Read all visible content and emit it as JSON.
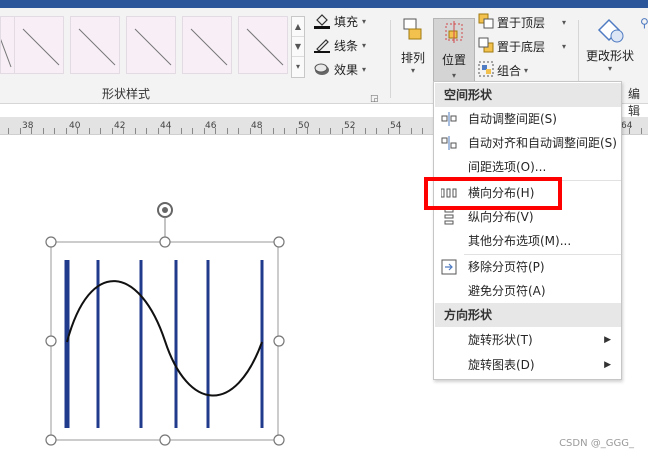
{
  "ribbon": {
    "shape_styles_label": "形状样式",
    "fill_label": "填充",
    "line_label": "线条",
    "effect_label": "效果",
    "arrange_label": "排列",
    "position_label": "位置",
    "bring_to_front_label": "置于顶层",
    "send_to_back_label": "置于底层",
    "group_label": "组合",
    "change_shape_label": "更改形状",
    "edit_label": "编辑"
  },
  "ruler": {
    "ticks": [
      "38",
      "40",
      "42",
      "44",
      "46",
      "48",
      "50",
      "52",
      "54",
      "64"
    ]
  },
  "menu": {
    "section1_title": "空间形状",
    "items1": [
      "自动调整间距(S)",
      "自动对齐和自动调整间距(S)",
      "间距选项(O)...",
      "横向分布(H)",
      "纵向分布(V)",
      "其他分布选项(M)...",
      "移除分页符(P)",
      "避免分页符(A)"
    ],
    "section2_title": "方向形状",
    "items2": [
      "旋转形状(T)",
      "旋转图表(D)"
    ]
  },
  "colors": {
    "ribbon_top": "#2b579a",
    "bar_blue": "#203a8c",
    "highlight": "#ff0000"
  },
  "watermark": "CSDN @_GGG_"
}
